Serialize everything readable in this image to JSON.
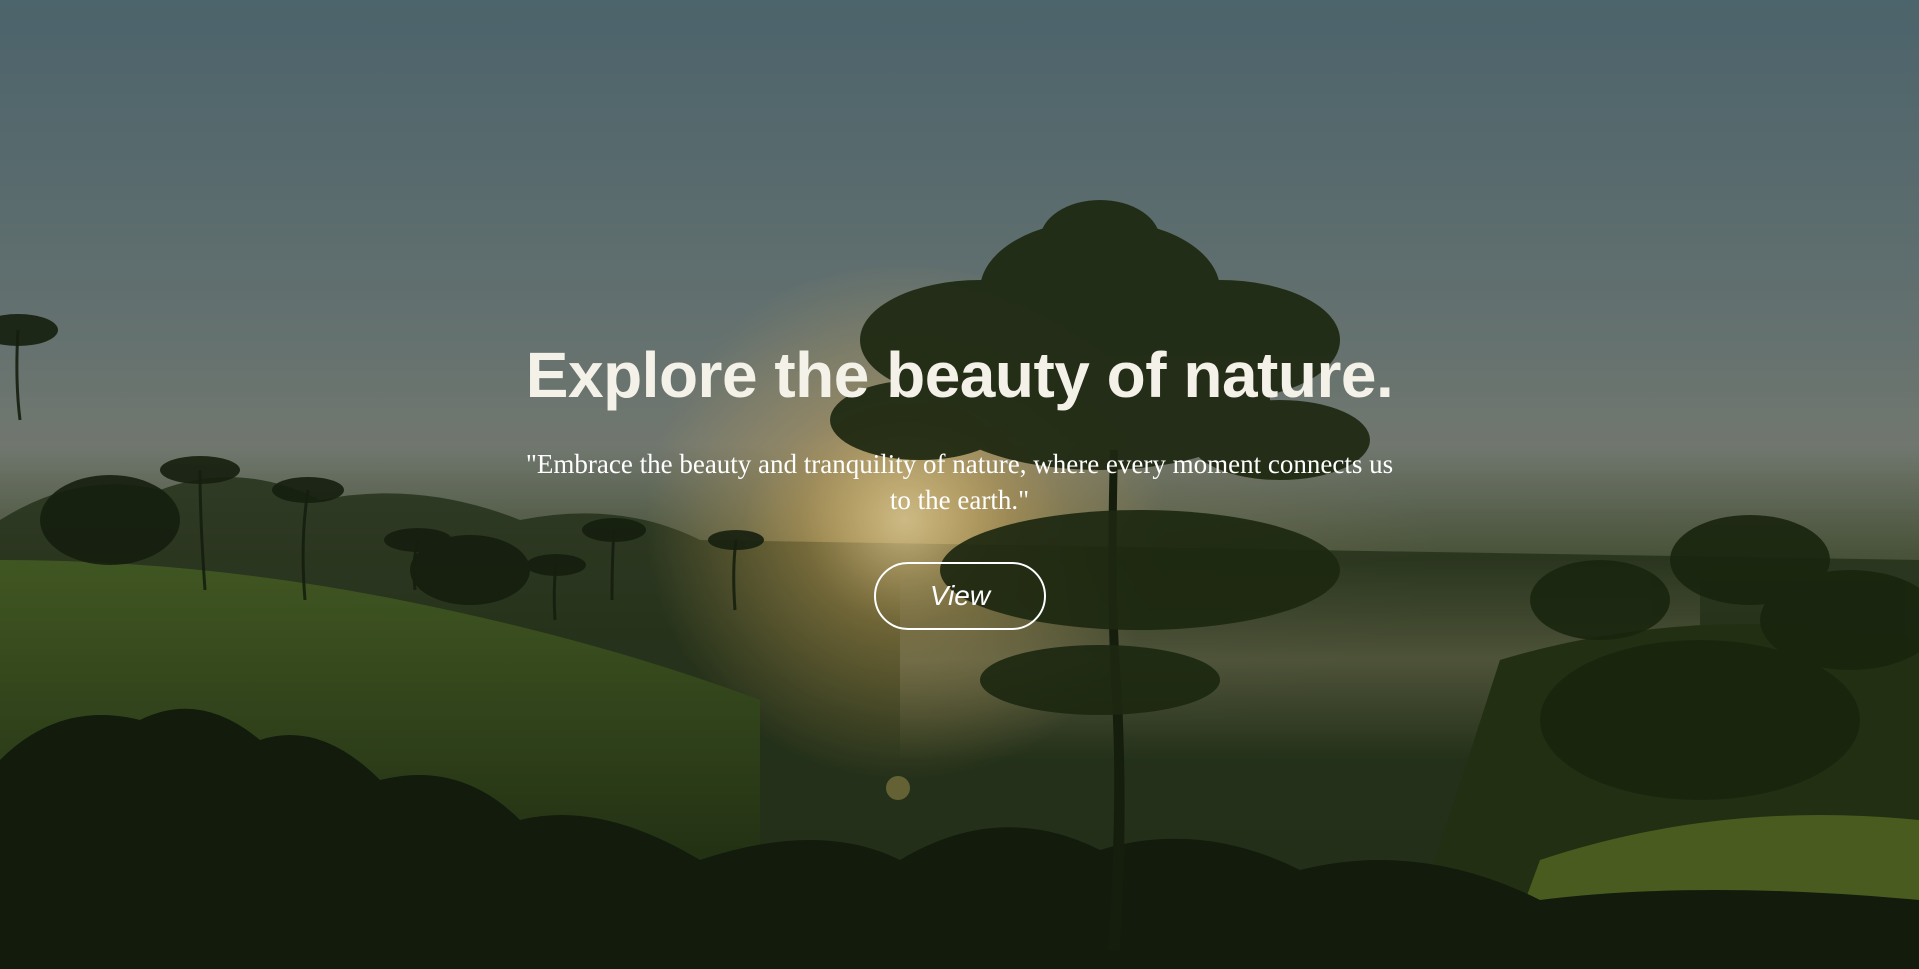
{
  "hero": {
    "title": "Explore the beauty of nature.",
    "quote": "\"Embrace the beauty and tranquility of nature, where every moment connects us to the earth.\"",
    "button_label": "View",
    "background_icon": "nature-landscape-photo"
  },
  "colors": {
    "text": "#ffffff",
    "title": "#f4f1e8"
  }
}
